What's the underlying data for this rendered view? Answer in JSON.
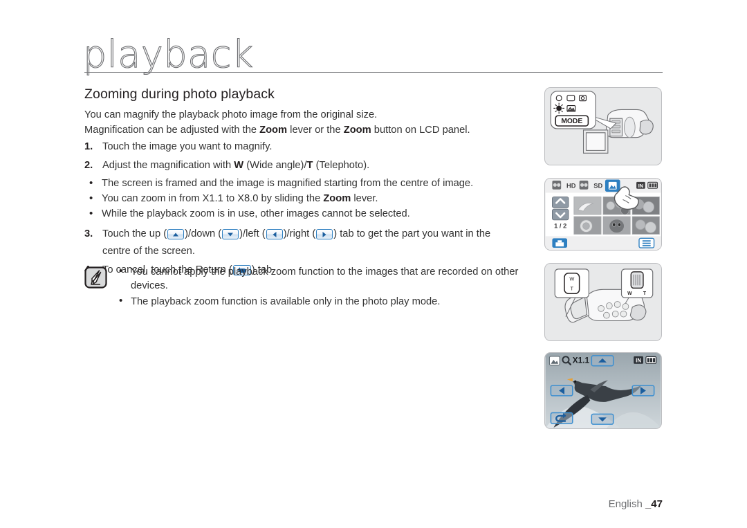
{
  "header": {
    "chapter_title": "playback",
    "section_title": "Zooming during photo playback"
  },
  "intro": {
    "line1": "You can magnify the playback photo image from the original size.",
    "line2_a": "Magnification can be adjusted with the ",
    "line2_zoom1": "Zoom",
    "line2_b": " lever or the ",
    "line2_zoom2": "Zoom",
    "line2_c": " button on LCD panel."
  },
  "steps": [
    {
      "num": "1.",
      "text": "Touch the image you want to magnify."
    },
    {
      "num": "2.",
      "text_a": "Adjust the magnification with ",
      "bold_w": "W",
      "text_b": " (Wide angle)/",
      "bold_t": "T",
      "text_c": " (Telephoto).",
      "bullets": [
        "The screen is framed and the image is magnified starting from the centre of image.",
        "You can zoom in from X1.1 to X8.0 by sliding the Zoom lever.",
        "While the playback zoom is in use, other images cannot be selected."
      ],
      "bullet2_a": "You can zoom in from X1.1 to X8.0 by sliding the ",
      "bullet2_zoom": "Zoom",
      "bullet2_b": " lever."
    },
    {
      "num": "3.",
      "t1": "Touch the up (",
      "t2": ")/down (",
      "t3": ")/left (",
      "t4": ")/right (",
      "t5": ") tab to get the part you want in the",
      "t6": "centre of the screen."
    },
    {
      "num": "4.",
      "t1": "To cancel, touch the Return (",
      "t2": ") tab."
    }
  ],
  "note": {
    "icon_name": "note-pen-icon",
    "bullets": [
      "You cannot apply the playback zoom function to the images that are recorded on other devices.",
      "The playback zoom function is available only in the photo play mode."
    ]
  },
  "figures": {
    "fig1": {
      "name": "camcorder-mode-button-illustration",
      "callout_label": "MODE",
      "icons": [
        "record-icon",
        "video-icon",
        "photo-icon",
        "lamp-icon",
        "play-icon"
      ]
    },
    "fig2": {
      "name": "thumbnail-index-lcd-illustration",
      "tabs": [
        "HD",
        "SD"
      ],
      "photo_tab_selected": true,
      "page_indicator": "1 / 2",
      "status_in": "IN",
      "battery": "battery-icon",
      "left_button": "folder-bag-icon",
      "right_button": "menu-list-icon",
      "nav_up": "chevron-up-icon",
      "nav_down": "chevron-down-icon",
      "finger": "hand-touch-icon"
    },
    "fig3": {
      "name": "camcorder-zoom-lever-illustration",
      "callout_left_w": "W",
      "callout_left_t": "T",
      "callout_right_w": "W",
      "callout_right_t": "T"
    },
    "fig4": {
      "name": "photo-playback-zoom-lcd-illustration",
      "mode_icon": "photo-mode-icon",
      "magnifier_icon": "magnifier-icon",
      "zoom_value": "X1.1",
      "status_in": "IN",
      "battery": "battery-icon",
      "buttons": [
        "up-arrow-button",
        "down-arrow-button",
        "left-arrow-button",
        "right-arrow-button",
        "return-button"
      ]
    }
  },
  "footer": {
    "language": "English ",
    "page": "_47"
  },
  "colors": {
    "accent_blue": "#2d7fc1",
    "arrow_blue": "#1b5e9e",
    "text": "#231f20",
    "muted": "#6d6e71",
    "frame_bg": "#e8e9ea"
  }
}
